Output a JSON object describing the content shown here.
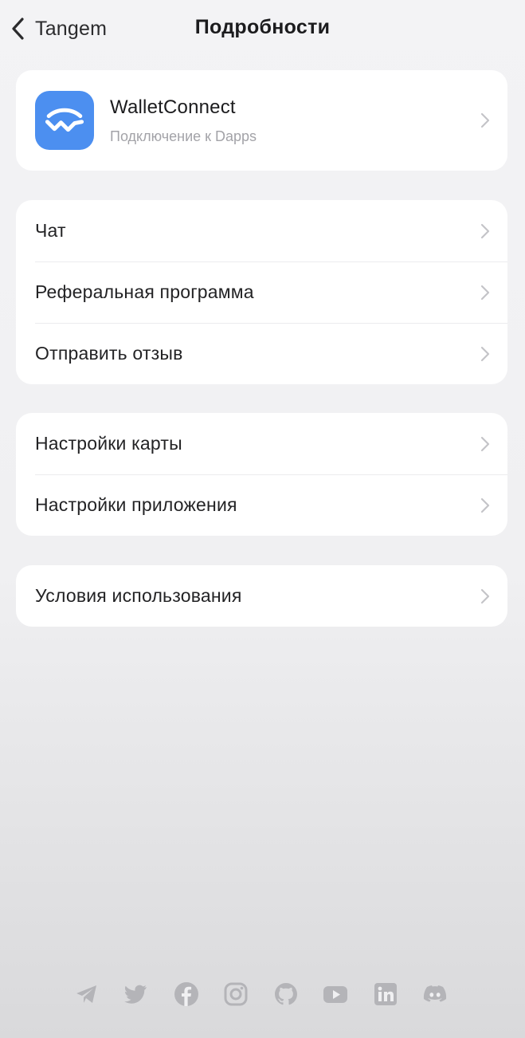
{
  "nav": {
    "back_label": "Tangem",
    "title": "Подробности"
  },
  "walletconnect": {
    "title": "WalletConnect",
    "subtitle": "Подключение к Dapps",
    "icon": "walletconnect-icon",
    "accent": "#4c8ff0"
  },
  "group1": {
    "items": [
      {
        "label": "Чат"
      },
      {
        "label": "Реферальная программа"
      },
      {
        "label": "Отправить отзыв"
      }
    ]
  },
  "group2": {
    "items": [
      {
        "label": "Настройки карты"
      },
      {
        "label": "Настройки приложения"
      }
    ]
  },
  "group3": {
    "items": [
      {
        "label": "Условия использования"
      }
    ]
  },
  "social": {
    "icons": [
      "telegram-icon",
      "twitter-icon",
      "facebook-icon",
      "instagram-icon",
      "github-icon",
      "youtube-icon",
      "linkedin-icon",
      "discord-icon"
    ],
    "color": "#b4b4b8"
  }
}
